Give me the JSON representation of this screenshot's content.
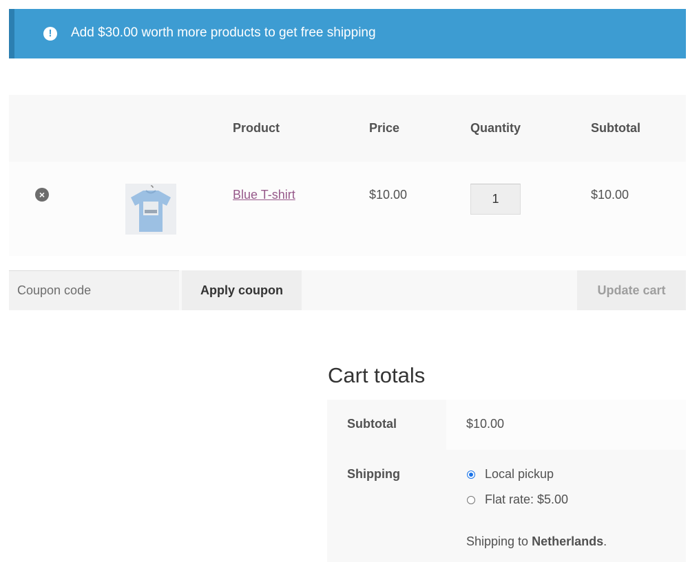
{
  "notice": {
    "icon": "exclamation-circle-icon",
    "text": "Add $30.00 worth more products to get free shipping",
    "color": "#3d9cd2"
  },
  "cart": {
    "headers": {
      "product": "Product",
      "price": "Price",
      "quantity": "Quantity",
      "subtotal": "Subtotal"
    },
    "items": [
      {
        "name": "Blue T-shirt",
        "price": "$10.00",
        "quantity": "1",
        "subtotal": "$10.00",
        "thumb": "blue-tshirt-image",
        "remove_icon": "remove-circle-icon"
      }
    ]
  },
  "actions": {
    "coupon_placeholder": "Coupon code",
    "apply_label": "Apply coupon",
    "update_label": "Update cart"
  },
  "totals": {
    "title": "Cart totals",
    "subtotal_label": "Subtotal",
    "subtotal_value": "$10.00",
    "shipping_label": "Shipping",
    "shipping_options": [
      {
        "label": "Local pickup",
        "selected": true
      },
      {
        "label": "Flat rate: $5.00",
        "selected": false
      }
    ],
    "shipping_to_prefix": "Shipping to ",
    "shipping_country": "Netherlands",
    "shipping_to_suffix": "."
  },
  "colors": {
    "link": "#96588a",
    "notice": "#3d9cd2",
    "radio": "#1a73e8"
  }
}
